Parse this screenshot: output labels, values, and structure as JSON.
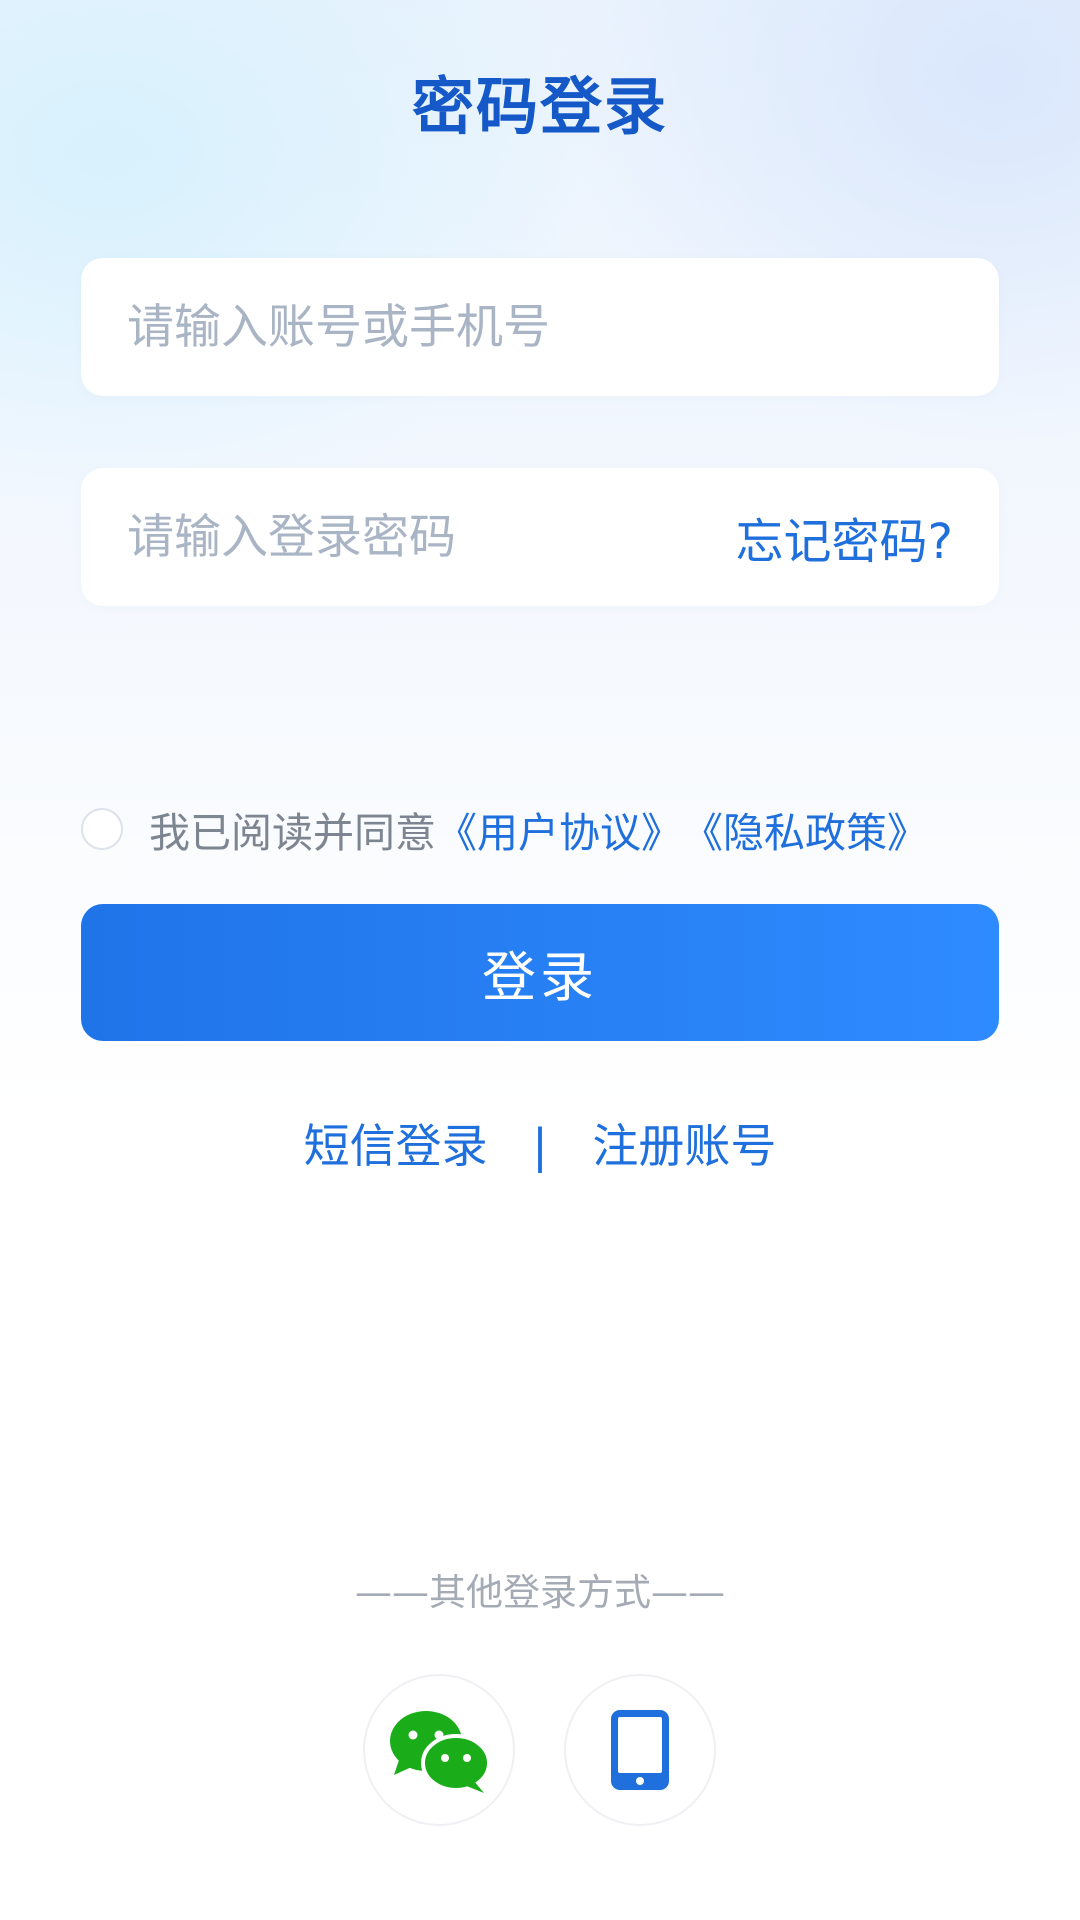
{
  "page": {
    "title": "密码登录"
  },
  "form": {
    "account_placeholder": "请输入账号或手机号",
    "password_placeholder": "请输入登录密码",
    "forgot_password": "忘记密码?"
  },
  "agreement": {
    "prefix": "我已阅读并同意",
    "user_agreement": "《用户协议》",
    "privacy_policy": "《隐私政策》",
    "checked": false
  },
  "login_button": "登录",
  "alt_links": {
    "sms_login": "短信登录",
    "separator": "|",
    "register": "注册账号"
  },
  "other_login": {
    "title": "——其他登录方式——",
    "methods": [
      {
        "icon": "wechat-icon",
        "color": "#1aad19"
      },
      {
        "icon": "phone-icon",
        "color": "#1f6fdc"
      }
    ]
  },
  "colors": {
    "accent": "#1f6fdc",
    "title": "#1459c7",
    "button_start": "#1f74e8",
    "button_end": "#2e8bff",
    "wechat": "#1aad19"
  }
}
